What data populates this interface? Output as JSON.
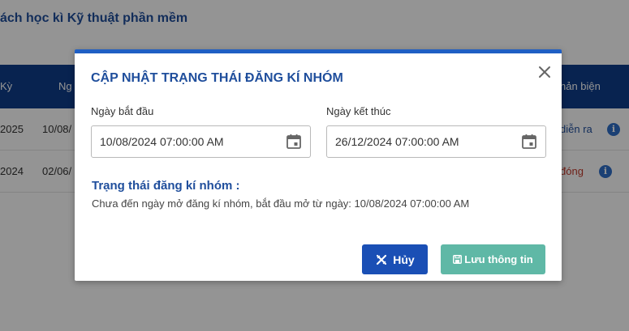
{
  "background": {
    "title": "ách học kì Kỹ thuật phần mềm",
    "headers": [
      {
        "label": "Kỳ"
      },
      {
        "label": "Ng"
      },
      {
        "label": "hản biện"
      }
    ],
    "rows": [
      {
        "c0": "2025",
        "c1": "10/08/",
        "status": "diễn ra"
      },
      {
        "c0": "2024",
        "c1": "02/06/",
        "status": "đóng"
      }
    ],
    "info_glyph": "i"
  },
  "modal": {
    "title": "CẬP NHẬT TRẠNG THÁI ĐĂNG KÍ NHÓM",
    "start_label": "Ngày bắt đầu",
    "start_value": "10/08/2024 07:00:00 AM",
    "end_label": "Ngày kết thúc",
    "end_value": "26/12/2024 07:00:00 AM",
    "status_title": "Trạng thái đăng kí nhóm :",
    "status_text": "Chưa đến ngày mở đăng kí nhóm, bắt đầu mở từ ngày: 10/08/2024 07:00:00 AM",
    "cancel_label": "Hủy",
    "save_label": "Lưu thông tin"
  },
  "colors": {
    "primary": "#1f4e9c",
    "accent_bar": "#1f5fc4",
    "cancel_button": "#1a4fb5",
    "save_button": "#5fb8a6",
    "table_header": "#0f3d8a"
  },
  "icons": {
    "close": "close-icon",
    "calendar": "calendar-icon",
    "cancel": "cancel-x-icon",
    "save": "save-icon",
    "info": "info-icon"
  }
}
